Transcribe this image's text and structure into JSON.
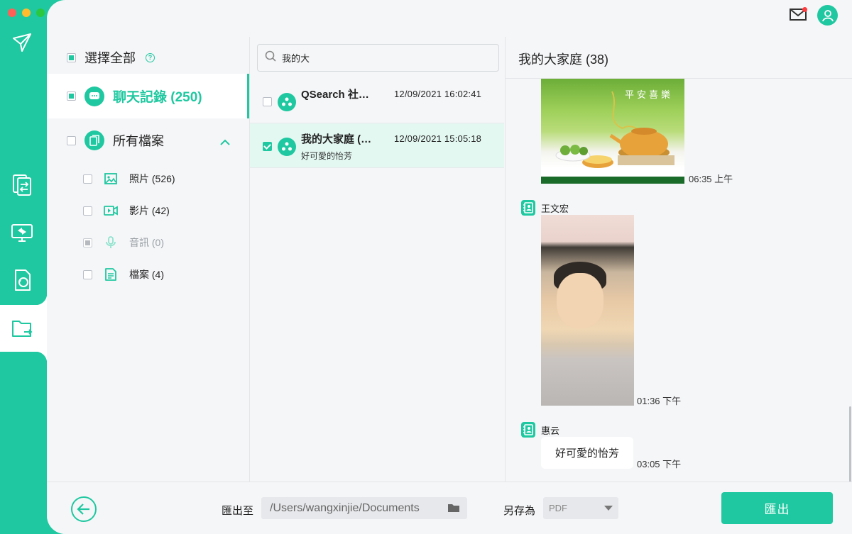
{
  "colors": {
    "accent": "#1fc8a0",
    "selected_row_bg": "#e4f8f2",
    "notification": "#ff3b3b"
  },
  "rail": {
    "icons": [
      "logo-icon",
      "transfer-icon",
      "screen-transfer-icon",
      "restore-icon",
      "folder-export-icon"
    ],
    "active": "folder-export-icon"
  },
  "header": {
    "icons": [
      "mail-icon",
      "user-avatar-icon"
    ]
  },
  "sidebar": {
    "select_all": "選擇全部",
    "chats": "聊天記錄 (250)",
    "all_files": "所有檔案",
    "items": [
      {
        "label": "照片 (526)",
        "icon": "image-icon"
      },
      {
        "label": "影片 (42)",
        "icon": "video-icon"
      },
      {
        "label": "音訊 (0)",
        "icon": "microphone-icon"
      },
      {
        "label": "檔案 (4)",
        "icon": "document-icon"
      }
    ]
  },
  "search": {
    "value": "我的大"
  },
  "conversations": [
    {
      "name": "QSearch 社…",
      "date": "12/09/2021 16:02:41",
      "preview": "",
      "checked": false
    },
    {
      "name": "我的大家庭 (…",
      "date": "12/09/2021 15:05:18",
      "preview": "好可愛的怡芳",
      "checked": true
    }
  ],
  "detail": {
    "title": "我的大家庭 (38)",
    "messages": [
      {
        "type": "image",
        "caption": "平安喜樂",
        "time": "06:35 上午"
      },
      {
        "sender": "王文宏",
        "type": "image",
        "time": "01:36 下午"
      },
      {
        "sender": "惠云",
        "type": "text",
        "text": "好可愛的怡芳",
        "time": "03:05 下午"
      }
    ]
  },
  "footer": {
    "export_to_label": "匯出至",
    "path": "/Users/wangxinjie/Documents",
    "save_as_label": "另存為",
    "format": "PDF",
    "export_button": "匯出"
  }
}
